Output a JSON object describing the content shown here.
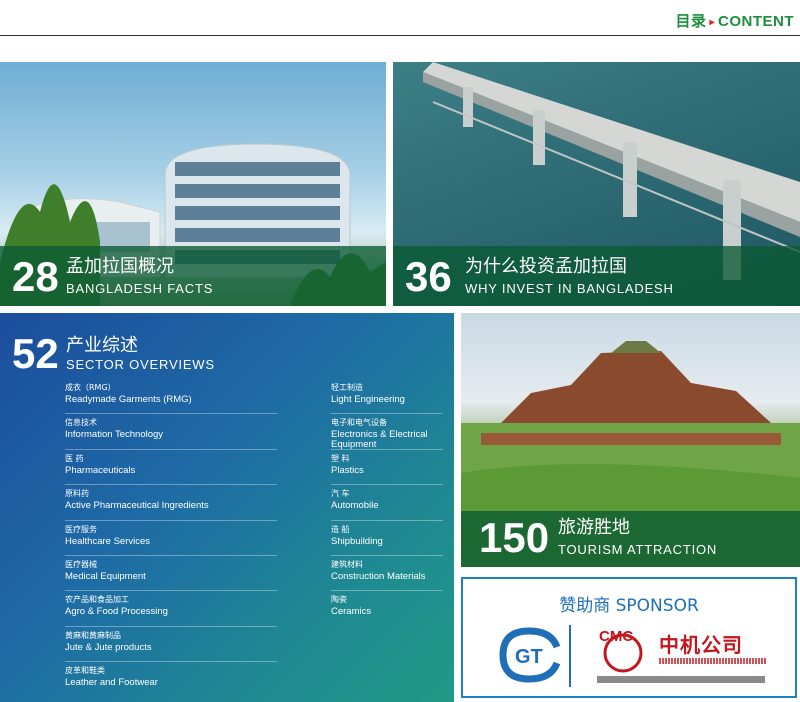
{
  "header": {
    "title_cn": "目录",
    "arrow": "▸",
    "title_en": "CONTENT"
  },
  "facts": {
    "number": "28",
    "title_cn": "孟加拉国概况",
    "title_en": "BANGLADESH FACTS"
  },
  "invest": {
    "number": "36",
    "title_cn": "为什么投资孟加拉国",
    "title_en": "WHY INVEST IN BANGLADESH"
  },
  "sector": {
    "number": "52",
    "title_cn": "产业综述",
    "title_en": "SECTOR OVERVIEWS",
    "left_items": [
      {
        "cn": "成衣（RMG）",
        "en": "Readymade Garments (RMG)"
      },
      {
        "cn": "信息技术",
        "en": "Information Technology"
      },
      {
        "cn": "医 药",
        "en": "Pharmaceuticals"
      },
      {
        "cn": "原料药",
        "en": "Active Pharmaceutical Ingredients"
      },
      {
        "cn": "医疗服务",
        "en": "Healthcare Services"
      },
      {
        "cn": "医疗器械",
        "en": "Medical Equipment"
      },
      {
        "cn": "农产品和食品加工",
        "en": "Agro & Food Processing"
      },
      {
        "cn": "黄麻和黄麻制品",
        "en": "Jute & Jute products"
      },
      {
        "cn": "皮革和鞋类",
        "en": "Leather and Footwear"
      }
    ],
    "right_items": [
      {
        "cn": "轻工制造",
        "en": "Light Engineering"
      },
      {
        "cn": "电子和电气设备",
        "en": "Electronics & Electrical Equipment"
      },
      {
        "cn": "塑 料",
        "en": "Plastics"
      },
      {
        "cn": "汽 车",
        "en": "Automobile"
      },
      {
        "cn": "造 船",
        "en": "Shipbuilding"
      },
      {
        "cn": "建筑材料",
        "en": "Construction Materials"
      },
      {
        "cn": "陶瓷",
        "en": "Ceramics"
      }
    ]
  },
  "tourism": {
    "number": "150",
    "title_cn": "旅游胜地",
    "title_en": "TOURISM ATTRACTION"
  },
  "sponsor": {
    "title": "赞助商 SPONSOR",
    "logo1_text": "GT",
    "logo2_badge": "CMC",
    "logo2_name": "中机公司"
  },
  "colors": {
    "brand_green": "#1b8f3b",
    "accent_red": "#d92b2b",
    "sponsor_blue": "#1f6fb8",
    "cmc_red": "#c4161c"
  }
}
